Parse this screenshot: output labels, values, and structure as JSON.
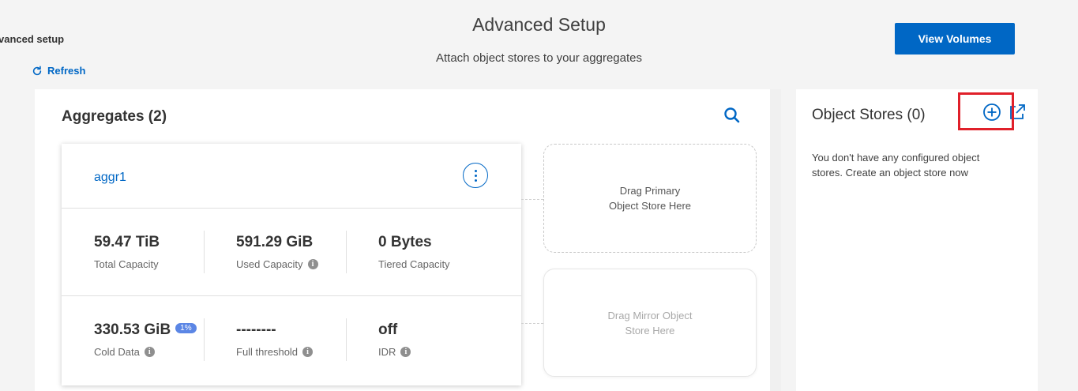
{
  "breadcrumb": "vanced setup",
  "refresh": {
    "label": "Refresh",
    "icon": "refresh-icon"
  },
  "header": {
    "title": "Advanced Setup",
    "subtitle": "Attach object stores to your aggregates",
    "view_button": "View Volumes"
  },
  "aggregates": {
    "title": "Aggregates (2)",
    "search_icon": "search-icon",
    "card": {
      "name": "aggr1",
      "menu_icon": "kebab-menu-icon",
      "metrics": [
        {
          "value": "59.47 TiB",
          "label": "Total Capacity",
          "info": false
        },
        {
          "value": "591.29 GiB",
          "label": "Used Capacity",
          "info": true
        },
        {
          "value": "0 Bytes",
          "label": "Tiered Capacity",
          "info": false
        },
        {
          "value": "330.53 GiB",
          "badge": "1%",
          "label": "Cold Data",
          "info": true
        },
        {
          "value": "--------",
          "label": "Full threshold",
          "info": true
        },
        {
          "value": "off",
          "label": "IDR",
          "info": true
        }
      ]
    },
    "drop_primary": {
      "line1": "Drag Primary",
      "line2": "Object Store Here"
    },
    "drop_mirror": {
      "line1": "Drag Mirror Object",
      "line2": "Store Here"
    }
  },
  "object_stores": {
    "title": "Object Stores (0)",
    "add_icon": "plus-circle-icon",
    "external_icon": "external-link-icon",
    "empty_message": "You don't have any configured object stores. Create an object store now"
  },
  "colors": {
    "accent": "#0067c5",
    "highlight": "#e0202a",
    "badge": "#5b86e5",
    "background": "#f4f4f4"
  }
}
